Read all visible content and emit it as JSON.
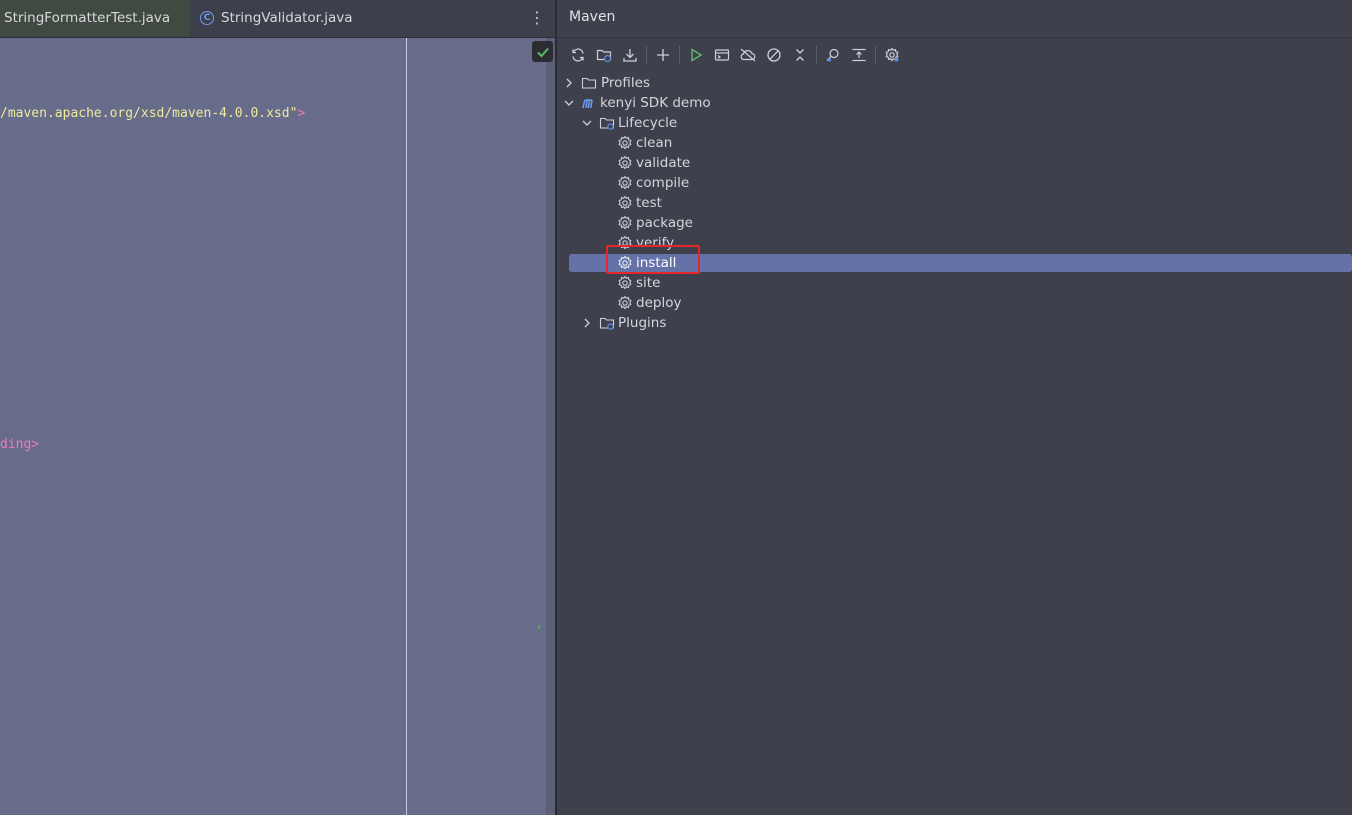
{
  "editor": {
    "tabs": [
      {
        "label": "StringFormatterTest.java",
        "active": true
      },
      {
        "label": "StringValidator.java",
        "active": false,
        "icon": "class-icon"
      }
    ],
    "menu_glyph": "⋮",
    "code": {
      "line1_string": "/maven.apache.org/xsd/maven-4.0.0.xsd\"",
      "line1_tag": ">",
      "line2_tag": "ding>"
    },
    "colors": {
      "background": "#676c8b",
      "string": "#eceb9c",
      "tag": "#f07bbd",
      "ok": "#5fb865"
    }
  },
  "maven": {
    "title": "Maven",
    "toolbar": [
      "reload-icon",
      "reload-folder-icon",
      "download-icon",
      "add-icon",
      "run-icon",
      "run-config-icon",
      "offline-icon",
      "skip-tests-icon",
      "collapse-icon",
      "analyze-icon",
      "show-deps-icon",
      "settings-icon"
    ],
    "tree": {
      "profiles": "Profiles",
      "project": "kenyi SDK demo",
      "lifecycle": "Lifecycle",
      "goals": [
        "clean",
        "validate",
        "compile",
        "test",
        "package",
        "verify",
        "install",
        "site",
        "deploy"
      ],
      "plugins": "Plugins",
      "selected_goal": "install"
    },
    "colors": {
      "selection": "#6472a8",
      "highlight": "#e6262b",
      "accent": "#5e8ee8",
      "run": "#5fb865"
    }
  }
}
